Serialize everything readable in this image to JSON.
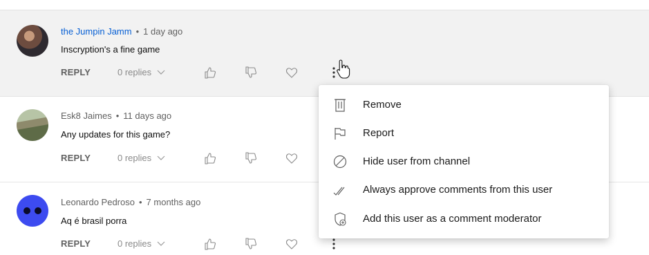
{
  "comments": [
    {
      "author": "the Jumpin Jamm",
      "time": "1 day ago",
      "text": "Inscryption's a fine game",
      "reply_label": "REPLY",
      "replies_label": "0 replies"
    },
    {
      "author": "Esk8 Jaimes",
      "time": "11 days ago",
      "text": "Any updates for this game?",
      "reply_label": "REPLY",
      "replies_label": "0 replies"
    },
    {
      "author": "Leonardo Pedroso",
      "time": "7 months ago",
      "text": "Aq é brasil porra",
      "reply_label": "REPLY",
      "replies_label": "0 replies"
    }
  ],
  "separator": "•",
  "menu": {
    "items": [
      {
        "label": "Remove",
        "icon": "trash-icon"
      },
      {
        "label": "Report",
        "icon": "flag-icon"
      },
      {
        "label": "Hide user from channel",
        "icon": "block-icon"
      },
      {
        "label": "Always approve comments from this user",
        "icon": "double-check-icon"
      },
      {
        "label": "Add this user as a comment moderator",
        "icon": "shield-add-icon"
      }
    ]
  },
  "colors": {
    "author_link": "#065fd4",
    "highlight_row": "#f2f2f2",
    "muted": "#606060"
  }
}
